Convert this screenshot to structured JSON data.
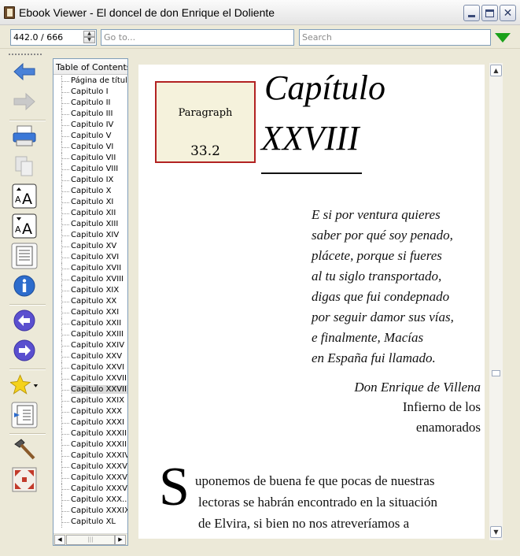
{
  "window": {
    "title": "Ebook Viewer - El doncel de don Enrique el Doliente",
    "minimize_icon": "minimize-icon",
    "maximize_icon": "maximize-icon",
    "close_glyph": "✕"
  },
  "toolbar": {
    "position_value": "442.0 / 666",
    "goto_placeholder": "Go to...",
    "search_placeholder": "Search",
    "spin_up": "▲",
    "spin_down": "▼"
  },
  "sidebar_icons": [
    "back-arrow-icon",
    "forward-arrow-icon",
    "print-icon",
    "copy-icon",
    "font-larger-icon",
    "font-smaller-icon",
    "page-view-icon",
    "info-icon",
    "previous-icon",
    "next-icon",
    "bookmark-star-icon",
    "table-of-contents-icon",
    "tools-icon",
    "fullscreen-icon"
  ],
  "colors": {
    "accent_blue": "#2f6fd1",
    "go_green": "#1aa11a",
    "para_border": "#b22222",
    "para_bg": "#f5f2dc",
    "info_purple": "#5a4fcf"
  },
  "toc": {
    "header": "Table of Contents",
    "items": [
      "Página de título",
      "Capitulo I",
      "Capitulo II",
      "Capitulo III",
      "Capitulo IV",
      "Capitulo V",
      "Capitulo VI",
      "Capitulo VII",
      "Capitulo VIII",
      "Capitulo IX",
      "Capitulo X",
      "Capitulo XI",
      "Capitulo XII",
      "Capitulo XIII",
      "Capitulo XIV",
      "Capitulo XV",
      "Capitulo XVI",
      "Capitulo XVII",
      "Capitulo XVIII",
      "Capitulo XIX",
      "Capitulo XX",
      "Capitulo XXI",
      "Capitulo XXII",
      "Capitulo XXIII",
      "Capitulo XXIV",
      "Capitulo XXV",
      "Capitulo XXVI",
      "Capitulo XXVII",
      "Capitulo XXVIII",
      "Capitulo XXIX",
      "Capitulo XXX",
      "Capitulo XXXI",
      "Capitulo XXXII",
      "Capitulo XXXIII",
      "Capitulo XXXIV",
      "Capitulo XXXV",
      "Capitulo XXXVI",
      "Capitulo XXXVI",
      "Capitulo XXX...",
      "Capitulo XXXIX",
      "Capitulo XL"
    ],
    "selected_index": 28,
    "scroll_left": "◀",
    "scroll_right": "▶",
    "scroll_grip": "|||"
  },
  "page": {
    "paragraph_label": "Paragraph",
    "paragraph_number": "33.2",
    "chapter_line1": "Capítulo",
    "chapter_line2": "XXVIII",
    "verse": [
      "E si por ventura quieres",
      "saber por qué soy penado,",
      "plácete, porque si fueres",
      "al tu siglo transportado,",
      "digas que fui condepnado",
      "por seguir damor sus vías,",
      "e finalmente, Macías",
      "en España fui llamado."
    ],
    "attribution_author": "Don Enrique de Villena",
    "attribution_work_line1": "Infierno de los",
    "attribution_work_line2": "enamorados",
    "drop_cap": "S",
    "body_lines": [
      "uponemos de buena fe que pocas de nuestras",
      "lectoras se habrán encontrado en la situación",
      "de Elvira, si bien no nos atreveríamos a"
    ]
  },
  "scrollbar": {
    "up": "▲",
    "down": "▼"
  }
}
